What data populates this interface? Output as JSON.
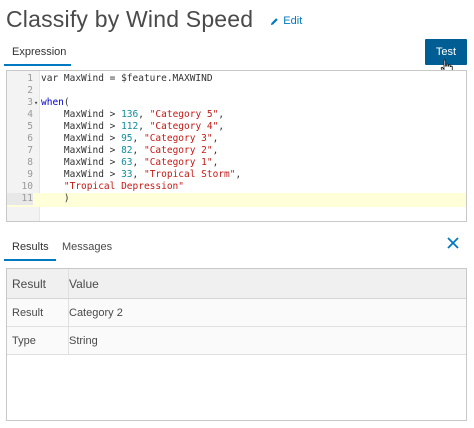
{
  "header": {
    "title": "Classify by Wind Speed",
    "edit_label": "Edit"
  },
  "top_tabs": [
    {
      "label": "Expression",
      "active": true
    }
  ],
  "test_button": {
    "label": "Test"
  },
  "editor": {
    "line_numbers": [
      "1",
      "2",
      "3",
      "4",
      "5",
      "6",
      "7",
      "8",
      "9",
      "10",
      "11"
    ],
    "active_line": 11,
    "lines": [
      {
        "pre": "var MaxWind = $feature.MAXWIND",
        "kw": "",
        "num": "",
        "mid": "",
        "str": "",
        "post": ""
      },
      {
        "pre": "",
        "kw": "",
        "num": "",
        "mid": "",
        "str": "",
        "post": ""
      },
      {
        "pre": "",
        "kw": "when",
        "num": "",
        "mid": "",
        "str": "",
        "post": "("
      },
      {
        "pre": "    MaxWind > ",
        "kw": "",
        "num": "136",
        "mid": ", ",
        "str": "\"Category 5\"",
        "post": ","
      },
      {
        "pre": "    MaxWind > ",
        "kw": "",
        "num": "112",
        "mid": ", ",
        "str": "\"Category 4\"",
        "post": ","
      },
      {
        "pre": "    MaxWind > ",
        "kw": "",
        "num": "95",
        "mid": ", ",
        "str": "\"Category 3\"",
        "post": ","
      },
      {
        "pre": "    MaxWind > ",
        "kw": "",
        "num": "82",
        "mid": ", ",
        "str": "\"Category 2\"",
        "post": ","
      },
      {
        "pre": "    MaxWind > ",
        "kw": "",
        "num": "63",
        "mid": ", ",
        "str": "\"Category 1\"",
        "post": ","
      },
      {
        "pre": "    MaxWind > ",
        "kw": "",
        "num": "33",
        "mid": ", ",
        "str": "\"Tropical Storm\"",
        "post": ","
      },
      {
        "pre": "    ",
        "kw": "",
        "num": "",
        "mid": "",
        "str": "\"Tropical Depression\"",
        "post": ""
      },
      {
        "pre": "    )",
        "kw": "",
        "num": "",
        "mid": "",
        "str": "",
        "post": ""
      }
    ]
  },
  "bottom_tabs": [
    {
      "label": "Results",
      "active": true
    },
    {
      "label": "Messages",
      "active": false
    }
  ],
  "results_table": {
    "headers": [
      "Result",
      "Value"
    ],
    "rows": [
      [
        "Result",
        "Category 2"
      ],
      [
        "Type",
        "String"
      ]
    ]
  },
  "colors": {
    "accent": "#0079c1",
    "button": "#005e95",
    "active_line": "#feffd8"
  }
}
